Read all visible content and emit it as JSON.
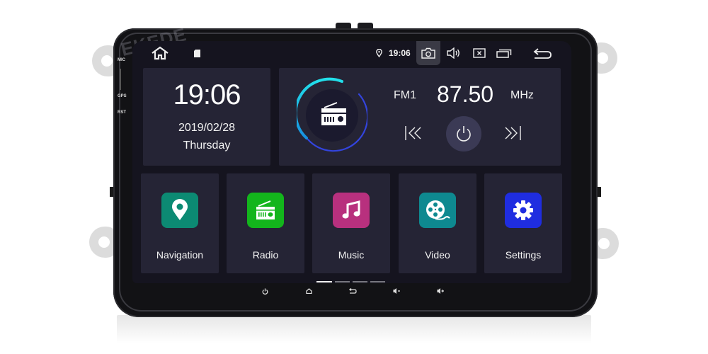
{
  "device": {
    "watermark": "EKEDE",
    "side_labels": [
      "MIC",
      "GPS",
      "RST"
    ]
  },
  "statusbar": {
    "home_icon": "home-icon",
    "sd_icon": "sd-card-icon",
    "location_icon": "location-pin-icon",
    "time": "19:06",
    "screenshot_icon": "camera-icon",
    "volume_icon": "speaker-icon",
    "close_icon": "close-box-icon",
    "recents_icon": "recent-apps-icon",
    "back_icon": "back-arrow-icon"
  },
  "clock": {
    "time": "19:06",
    "date": "2019/02/28",
    "day": "Thursday"
  },
  "radio": {
    "band": "FM1",
    "frequency": "87.50",
    "unit": "MHz",
    "prev_icon": "seek-back-icon",
    "power_icon": "power-icon",
    "next_icon": "seek-forward-icon"
  },
  "apps": [
    {
      "label": "Navigation",
      "icon": "map-pin-icon",
      "color": "#0c8a73"
    },
    {
      "label": "Radio",
      "icon": "radio-icon",
      "color": "#13b51c"
    },
    {
      "label": "Music",
      "icon": "music-note-icon",
      "color": "#b8307e"
    },
    {
      "label": "Video",
      "icon": "film-reel-icon",
      "color": "#0e8990"
    },
    {
      "label": "Settings",
      "icon": "gear-icon",
      "color": "#1f2de0"
    }
  ],
  "pager": {
    "pages": 4,
    "active": 1
  },
  "hardware_keys": [
    "power",
    "home",
    "back",
    "volume-down",
    "volume-up"
  ],
  "colors": {
    "screen_bg": "#15141f",
    "card_bg": "#252435",
    "dial_cyan": "#20d7e6",
    "dial_blue": "#3344dd",
    "power_btn": "#3b3a55"
  }
}
